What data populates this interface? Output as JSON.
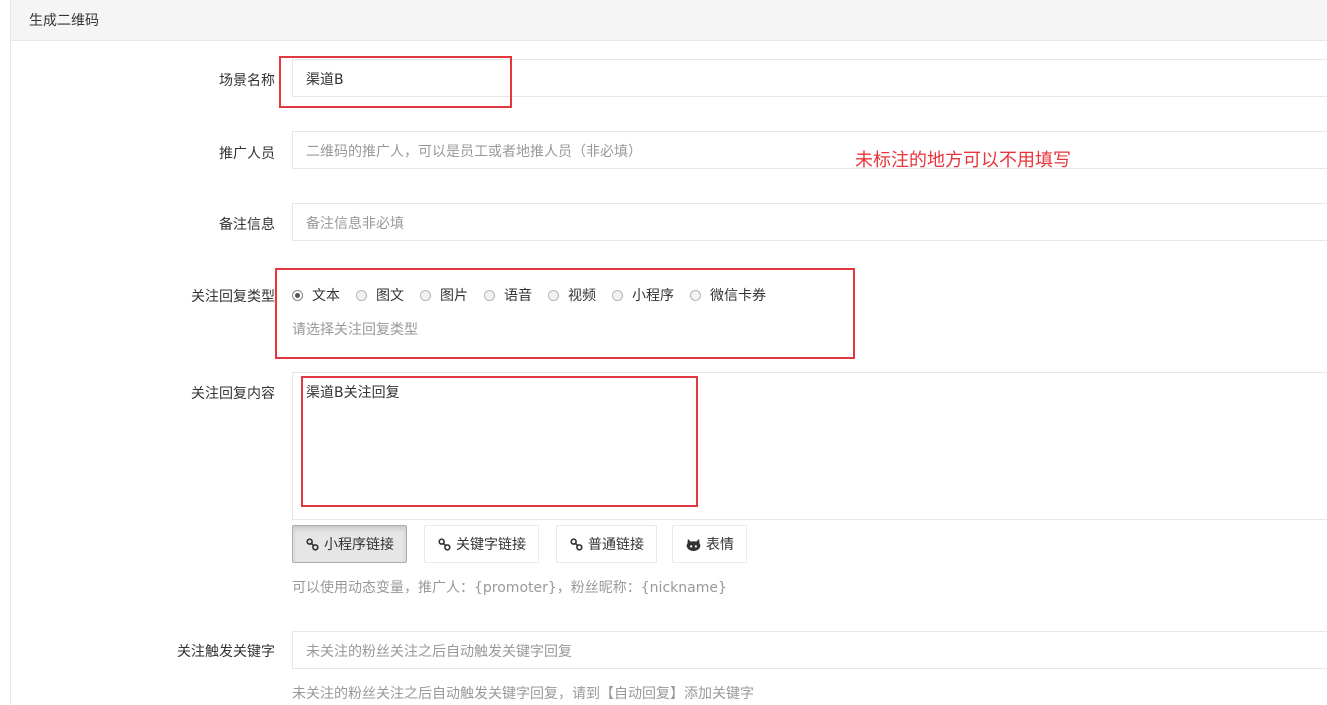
{
  "panel": {
    "title": "生成二维码"
  },
  "form": {
    "scene_name": {
      "label": "场景名称",
      "value": "渠道B"
    },
    "promoter": {
      "label": "推广人员",
      "placeholder": "二维码的推广人，可以是员工或者地推人员（非必填）"
    },
    "remark": {
      "label": "备注信息",
      "placeholder": "备注信息非必填"
    },
    "reply_type": {
      "label": "关注回复类型",
      "options": [
        "文本",
        "图文",
        "图片",
        "语音",
        "视频",
        "小程序",
        "微信卡券"
      ],
      "selected": "文本",
      "help": "请选择关注回复类型"
    },
    "reply_content": {
      "label": "关注回复内容",
      "value": "渠道B关注回复",
      "buttons": [
        {
          "label": "小程序链接",
          "icon": "link-icon"
        },
        {
          "label": "关键字链接",
          "icon": "link-icon"
        },
        {
          "label": "普通链接",
          "icon": "link-icon"
        },
        {
          "label": "表情",
          "icon": "github-icon"
        }
      ],
      "help": "可以使用动态变量，推广人：{promoter}，粉丝昵称：{nickname}"
    },
    "trigger_keyword": {
      "label": "关注触发关键字",
      "placeholder": "未关注的粉丝关注之后自动触发关键字回复",
      "help": "未关注的粉丝关注之后自动触发关键字回复，请到【自动回复】添加关键字"
    }
  },
  "annotation": {
    "note": "未标注的地方可以不用填写",
    "color": "#e8353b"
  }
}
